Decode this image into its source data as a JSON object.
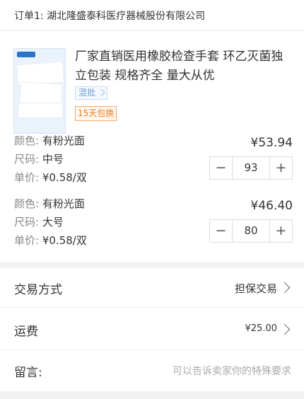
{
  "order": {
    "label": "订单1: 湖北隆盛泰科医疗器械股份有限公司"
  },
  "product": {
    "image_alt": "glove-package",
    "title": "厂家直销医用橡胶检查手套 环乙灭菌独立包装 规格齐全 量大从优",
    "tag_mix": "混批",
    "tag_return": "15天包换"
  },
  "skus": [
    {
      "color_key": "颜色:",
      "color_val": "有粉光面",
      "size_key": "尺码:",
      "size_val": "中号",
      "unit_key": "单价:",
      "unit_val": "¥0.58/双",
      "price": "¥53.94",
      "qty": "93",
      "minus": "−",
      "plus": "+"
    },
    {
      "color_key": "颜色:",
      "color_val": "有粉光面",
      "size_key": "尺码:",
      "size_val": "大号",
      "unit_key": "单价:",
      "unit_val": "¥0.58/双",
      "price": "¥46.40",
      "qty": "80",
      "minus": "−",
      "plus": "+"
    }
  ],
  "trade": {
    "label": "交易方式",
    "value": "担保交易"
  },
  "shipping": {
    "label": "运费",
    "value": "¥25.00"
  },
  "note": {
    "label": "留言:",
    "placeholder": "可以告诉卖家你的特殊要求"
  },
  "colors": {
    "accent_orange": "#f07d22",
    "tag_blue": "#6a9fd0"
  }
}
